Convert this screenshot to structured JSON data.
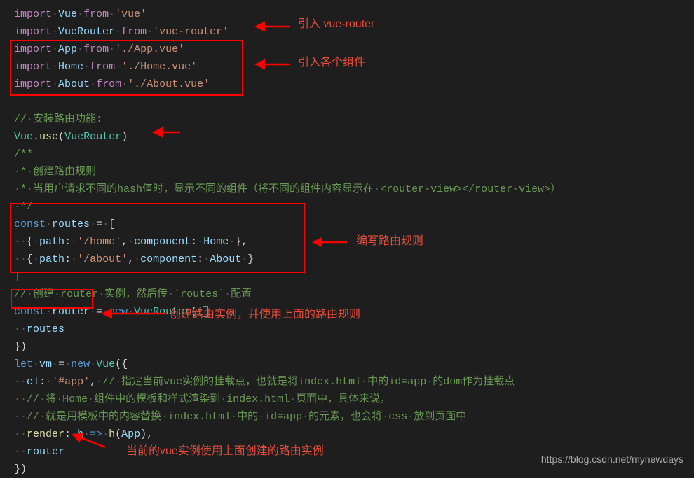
{
  "code": {
    "l1_import": "import",
    "l1_vue": "Vue",
    "l1_from": "from",
    "l1_str": "'vue'",
    "l2_import": "import",
    "l2_vr": "VueRouter",
    "l2_from": "from",
    "l2_str": "'vue-router'",
    "l3_import": "import",
    "l3_app": "App",
    "l3_from": "from",
    "l3_str": "'./App.vue'",
    "l4_import": "import",
    "l4_home": "Home",
    "l4_from": "from",
    "l4_str": "'./Home.vue'",
    "l5_import": "import",
    "l5_about": "About",
    "l5_from": "from",
    "l5_str": "'./About.vue'",
    "l6_cmt": "// 安装路由功能:",
    "l7_vue": "Vue",
    "l7_use": "use",
    "l7_vr": "VueRouter",
    "l8_cmt": "/**",
    "l9_cmt": " * 创建路由规则",
    "l10_cmt": " * 当用户请求不同的hash值时，显示不同的组件（将不同的组件内容显示在 <router-view></router-view>）",
    "l11_cmt": " */",
    "l12_const": "const",
    "l12_routes": "routes",
    "l13_path": "path",
    "l13_pathval": "'/home'",
    "l13_comp": "component",
    "l13_home": "Home",
    "l14_path": "path",
    "l14_pathval": "'/about'",
    "l14_comp": "component",
    "l14_about": "About",
    "l16_cmt": "// 创建 router 实例，然后传 `routes` 配置",
    "l17_const": "const",
    "l17_router": "router",
    "l17_new": "new",
    "l17_vr": "VueRouter",
    "l18_routes": "routes",
    "l20_let": "let",
    "l20_vm": "vm",
    "l20_new": "new",
    "l20_vue": "Vue",
    "l21_el": "el",
    "l21_elval": "'#app'",
    "l21_cmt": "// 指定当前vue实例的挂载点，也就是将index.html 中的id=app 的dom作为挂载点",
    "l22_cmt": "// 将 Home 组件中的模板和样式渲染到 index.html 页面中，具体来说，",
    "l23_cmt": "// 就是用模板中的内容替换 index.html 中的 id=app 的元素，也会将 css 放到页面中",
    "l24_render": "render",
    "l24_h": "h",
    "l24_h2": "h",
    "l24_app": "App",
    "l25_router": "router"
  },
  "annotations": {
    "a1": "引入 vue-router",
    "a2": "引入各个组件",
    "a3": "编写路由规则",
    "a4": "创建路由实例，并使用上面的路由规则",
    "a5": "当前的vue实例使用上面创建的路由实例"
  },
  "watermark": "https://blog.csdn.net/mynewdays"
}
